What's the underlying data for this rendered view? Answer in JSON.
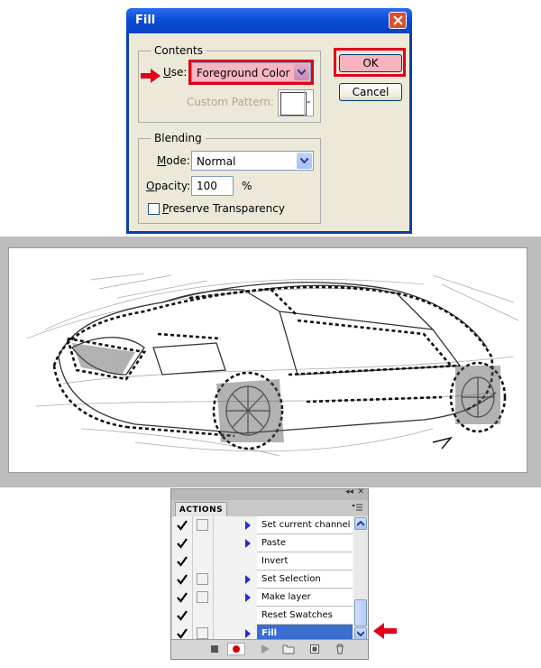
{
  "dialog": {
    "title": "Fill",
    "contents_group": "Contents",
    "use_label": "Use:",
    "use_value": "Foreground Color",
    "custom_pattern_label": "Custom Pattern:",
    "blending_group": "Blending",
    "mode_label": "Mode:",
    "mode_value": "Normal",
    "opacity_label": "Opacity:",
    "opacity_value": "100",
    "opacity_unit": "%",
    "preserve_label": "Preserve Transparency",
    "preserve_checked": false,
    "ok_label": "OK",
    "cancel_label": "Cancel"
  },
  "actions_panel": {
    "tab_label": "ACTIONS",
    "items": [
      {
        "label": "Set current channel",
        "checked": true,
        "has_dialog_box": true,
        "expandable": true,
        "selected": false
      },
      {
        "label": "Paste",
        "checked": true,
        "has_dialog_box": false,
        "expandable": true,
        "selected": false
      },
      {
        "label": "Invert",
        "checked": true,
        "has_dialog_box": false,
        "expandable": false,
        "selected": false
      },
      {
        "label": "Set Selection",
        "checked": true,
        "has_dialog_box": true,
        "expandable": true,
        "selected": false
      },
      {
        "label": "Make layer",
        "checked": true,
        "has_dialog_box": true,
        "expandable": true,
        "selected": false
      },
      {
        "label": "Reset Swatches",
        "checked": true,
        "has_dialog_box": false,
        "expandable": false,
        "selected": false
      },
      {
        "label": "Fill",
        "checked": true,
        "has_dialog_box": true,
        "expandable": true,
        "selected": true
      }
    ]
  },
  "colors": {
    "highlight": "#e3001b",
    "selection": "#3a6ed0",
    "dialog_face": "#ece9d8",
    "titlebar": "#0a4ad4"
  }
}
